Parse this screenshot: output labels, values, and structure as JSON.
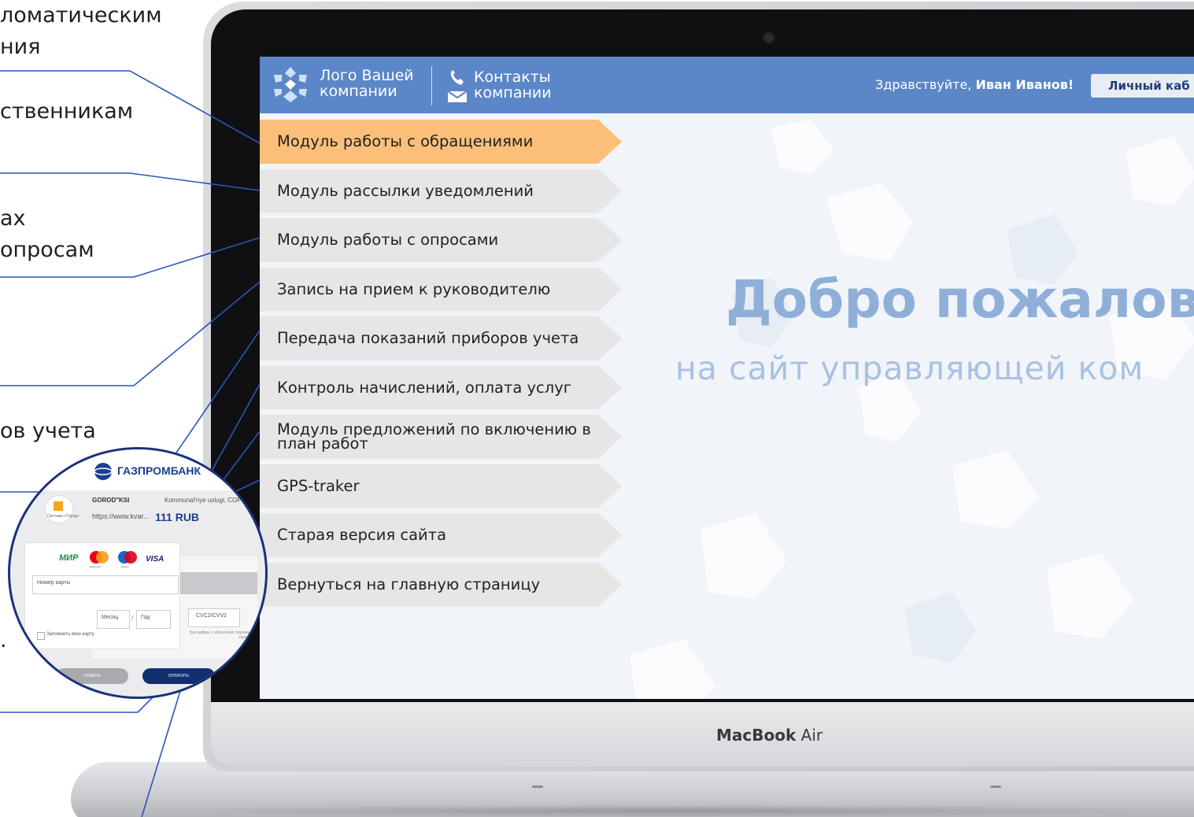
{
  "callouts": [
    "ломатическим\nния",
    "ственникам",
    "ах\nопросам",
    "ов учета",
    "."
  ],
  "laptop": {
    "brand_bold": "MacBook",
    "brand_light": "Air"
  },
  "header": {
    "logo_line1": "Лого Вашей",
    "logo_line2": "компании",
    "contacts_line1": "Контакты",
    "contacts_line2": "компании",
    "greeting_prefix": "Здравствуйте,",
    "greeting_name": "Иван Иванов!",
    "cabinet_label": "Личный каб"
  },
  "menu": [
    {
      "label": "Модуль работы с обращениями",
      "active": true
    },
    {
      "label": "Модуль рассылки уведомлений",
      "active": false
    },
    {
      "label": "Модуль работы с опросами",
      "active": false
    },
    {
      "label": "Запись на прием  к руководителю",
      "active": false
    },
    {
      "label": "Передача показаний приборов учета",
      "active": false
    },
    {
      "label": "Контроль начислений, оплата услуг",
      "active": false
    },
    {
      "label": "Модуль предложений по включению в план работ",
      "active": false
    },
    {
      "label": "GPS-traker",
      "active": false
    },
    {
      "label": "Старая версия сайта",
      "active": false
    },
    {
      "label": "Вернуться на главную страницу",
      "active": false
    }
  ],
  "welcome": {
    "title": "Добро пожалов",
    "subtitle": "на сайт управляющей ком"
  },
  "payment": {
    "bank": "ГАЗПРОМБАНК",
    "merchant": "GOROD\"KSI",
    "merchant_url": "https://www.kvar...",
    "description": "Kommunal'nye uslugi, COP - Xa",
    "amount": "111 RUB",
    "system_label": "Система «Город»",
    "card_brands": [
      "МИР",
      "mastercard",
      "maestro",
      "VISA"
    ],
    "card_number_placeholder": "Номер карты",
    "month_placeholder": "Месяц",
    "year_placeholder": "Год",
    "cvc_placeholder": "CVC2/CVV2",
    "cvc_hint": "Три цифры с оборотной стороны карты",
    "remember_label": "Запомнить мою карту",
    "cancel_label": "ОТМЕНА",
    "pay_label": "ОПЛАТИТЬ"
  },
  "colors": {
    "header": "#5b86c8",
    "menu_active": "#fbbf7a",
    "menu_item": "#e6e6e6",
    "welcome_title": "#8fafd9",
    "welcome_subtitle": "#a9c1e2",
    "callout_line": "#2a55b8",
    "pay_button": "#0f2f6f"
  }
}
